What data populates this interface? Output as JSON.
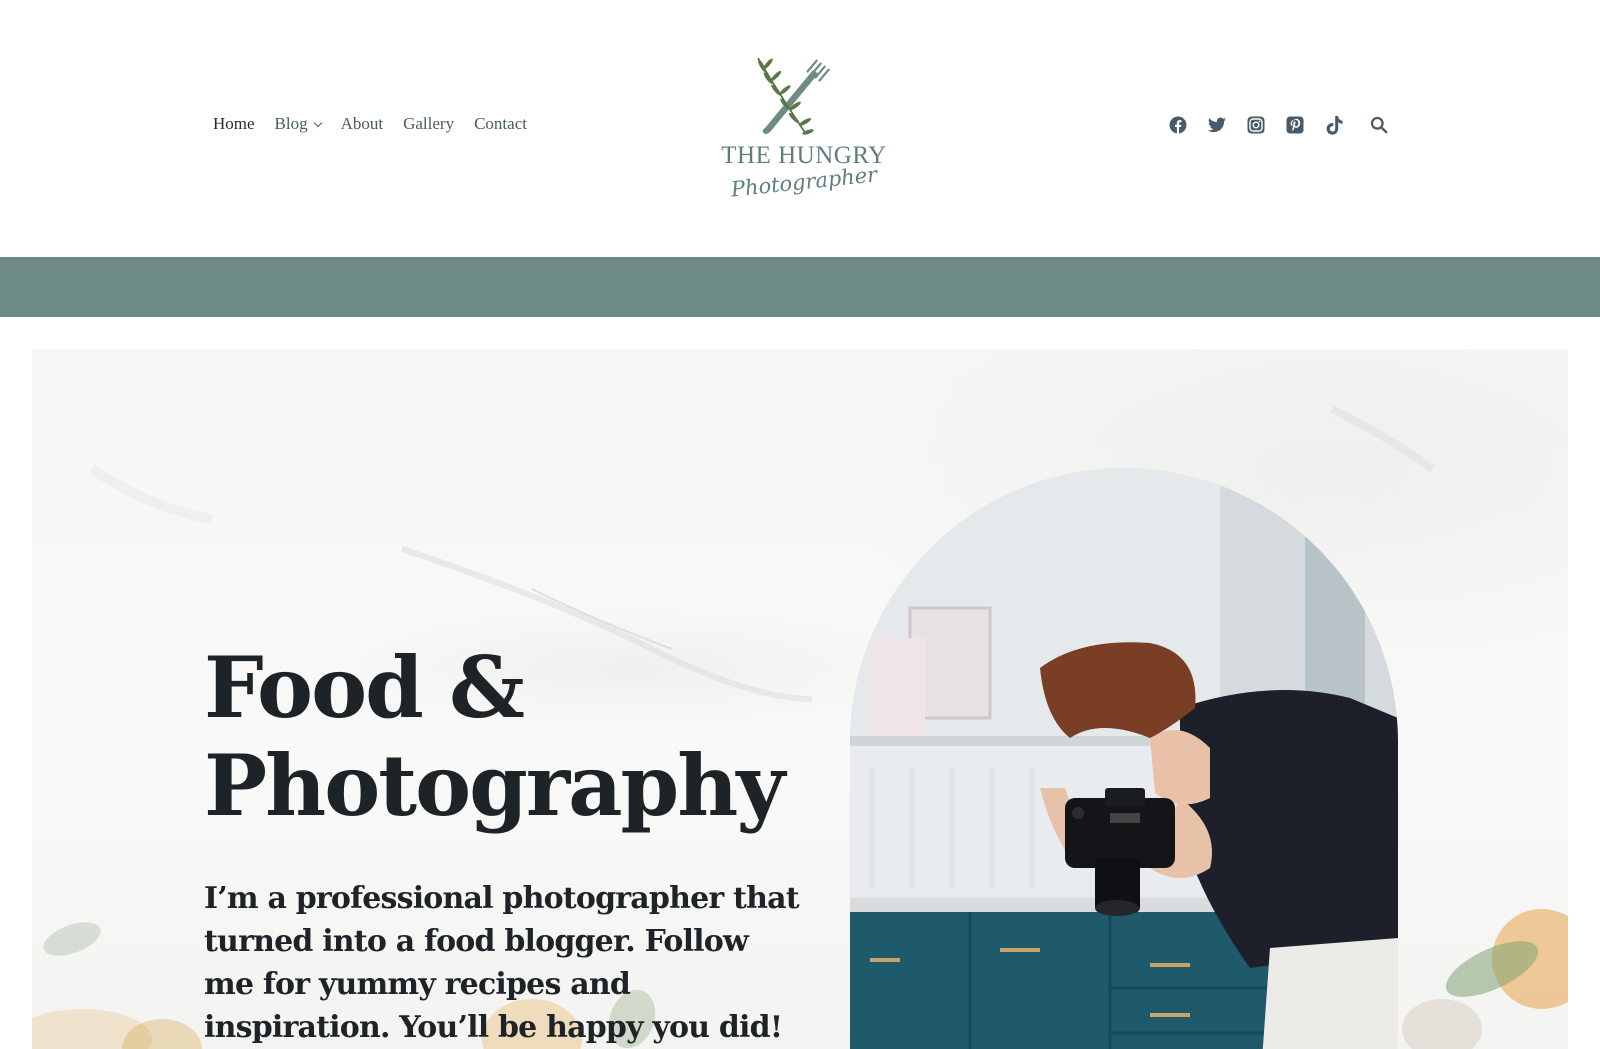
{
  "header": {
    "nav": [
      {
        "label": "Home",
        "active": true
      },
      {
        "label": "Blog",
        "has_dropdown": true
      },
      {
        "label": "About"
      },
      {
        "label": "Gallery"
      },
      {
        "label": "Contact"
      }
    ],
    "logo": {
      "title": "THE HUNGRY",
      "script": "Photographer",
      "icon": "crossed-fork-rosemary-icon"
    },
    "social_icons": [
      "facebook-icon",
      "twitter-icon",
      "instagram-icon",
      "pinterest-icon",
      "tiktok-icon",
      "search-icon"
    ]
  },
  "colors": {
    "accent": "#6f8b86",
    "nav_text": "#4a5a66",
    "heading": "#1e2328",
    "logo": "#5e7f7b"
  },
  "hero": {
    "title_line1": "Food &",
    "title_line2": "Photography",
    "text": "I’m a professional photographer that turned into a food blogger. Follow me for yummy recipes and inspiration. You’ll be happy you did!",
    "image": "photographer-with-camera-in-kitchen"
  }
}
